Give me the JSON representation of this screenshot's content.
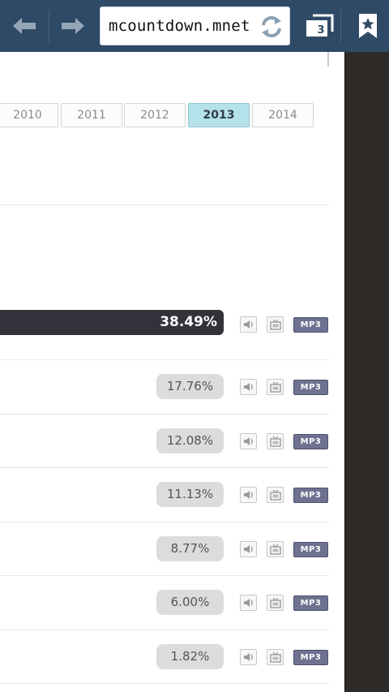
{
  "browser": {
    "url": "mcountdown.mnet",
    "tab_count": "3",
    "icons": {
      "back": "back-arrow-icon",
      "forward": "forward-arrow-icon",
      "reload": "reload-icon",
      "tabs": "tabs-icon",
      "bookmark": "bookmark-star-icon"
    }
  },
  "years": {
    "tabs": [
      "2010",
      "2011",
      "2012",
      "2013",
      "2014"
    ],
    "active": "2013"
  },
  "results": {
    "percentages": [
      "38.49%",
      "17.76%",
      "12.08%",
      "11.13%",
      "8.77%",
      "6.00%",
      "1.82%"
    ],
    "mp3_label": "MP3"
  },
  "colors": {
    "toolbar": "#2f4a66",
    "active_tab": "#b5e1ea",
    "leading_bar": "#34313a",
    "mp3_button": "#6e7190"
  }
}
